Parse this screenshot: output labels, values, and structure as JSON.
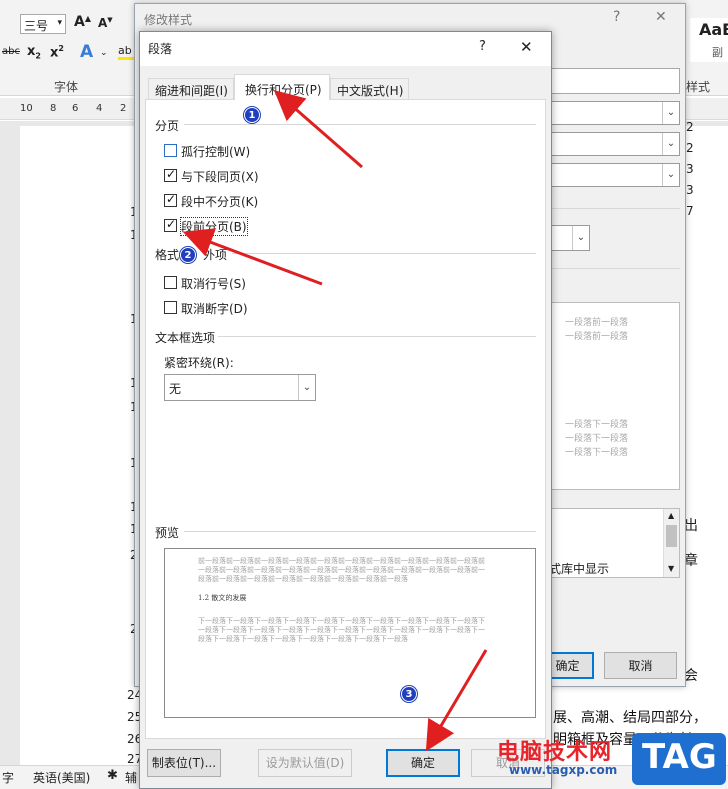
{
  "ribbon": {
    "font_size_value": "三号",
    "font_group_label": "字体",
    "style_preview": "AaB",
    "style_preview_sub": "副",
    "style_label": "样式",
    "ruler_ticks": [
      "10",
      "8",
      "6",
      "4",
      "2"
    ]
  },
  "doc": {
    "left_margin_nums": [
      "1",
      "1",
      "1",
      "1",
      "1",
      "1",
      "1",
      "1",
      "2",
      "2",
      "24",
      "25",
      "26",
      "27"
    ],
    "line_25_text": "展、高潮、结局四部分，",
    "line_26_text": "明箱框及容量可分为长",
    "right_nums": [
      "2",
      "2",
      "3",
      "3",
      "7"
    ],
    "right_chars": [
      "出",
      "章",
      "会"
    ]
  },
  "statusbar": {
    "word_label": "字",
    "language": "英语(美国)",
    "assist": "辅"
  },
  "modify_style_dialog": {
    "title": "修改样式",
    "help": "?",
    "close": "✕",
    "show_in_library": "式库中显示",
    "ok": "确定",
    "cancel": "取消",
    "preview_prev": "一段落前一段落",
    "preview_next": "一段落下一段落"
  },
  "paragraph_dialog": {
    "title": "段落",
    "help": "?",
    "close": "✕",
    "tabs": [
      {
        "label": "缩进和间距(I)",
        "active": false
      },
      {
        "label": "换行和分页(P)",
        "active": true
      },
      {
        "label": "中文版式(H)",
        "active": false
      }
    ],
    "pagination": {
      "heading": "分页",
      "options": [
        {
          "label": "孤行控制(W)",
          "checked": false
        },
        {
          "label": "与下段同页(X)",
          "checked": true
        },
        {
          "label": "段中不分页(K)",
          "checked": true
        },
        {
          "label": "段前分页(B)",
          "checked": true
        }
      ]
    },
    "exceptions": {
      "heading_left": "格式",
      "heading_right": "外项",
      "options": [
        {
          "label": "取消行号(S)",
          "checked": false
        },
        {
          "label": "取消断字(D)",
          "checked": false
        }
      ]
    },
    "textbox": {
      "heading": "文本框选项",
      "tight_wrap_label": "紧密环绕(R):",
      "tight_wrap_value": "无"
    },
    "preview": {
      "heading": "预览",
      "prev_text": "前一段落前一段落前一段落前一段落前一段落前一段落前一段落前一段落前一段落前一段落前一段落前一段落前一段落前一段落前一段落前一段落前一段落前一段落前一段落前一段落前一段落前一段落前一段落前一段落前一段落前一段落前一段落前一段落",
      "sample_heading": "1.2 散文的发展",
      "next_text": "下一段落下一段落下一段落下一段落下一段落下一段落下一段落下一段落下一段落下一段落下一段落下一段落下一段落下一段落下一段落下一段落下一段落下一段落下一段落下一段落下一段落下一段落下一段落下一段落下一段落下一段落下一段落下一段落"
    },
    "buttons": {
      "tabs": "制表位(T)...",
      "set_default": "设为默认值(D)",
      "ok": "确定",
      "cancel": "取消"
    }
  },
  "annotations": {
    "badges": [
      "1",
      "2",
      "3"
    ],
    "arrow_color": "#e02020",
    "badge_color": "#1f3fbf"
  },
  "watermark": {
    "site_cn": "电脑技术网",
    "site_url": "www.tagxp.com",
    "tag": "TAG"
  }
}
